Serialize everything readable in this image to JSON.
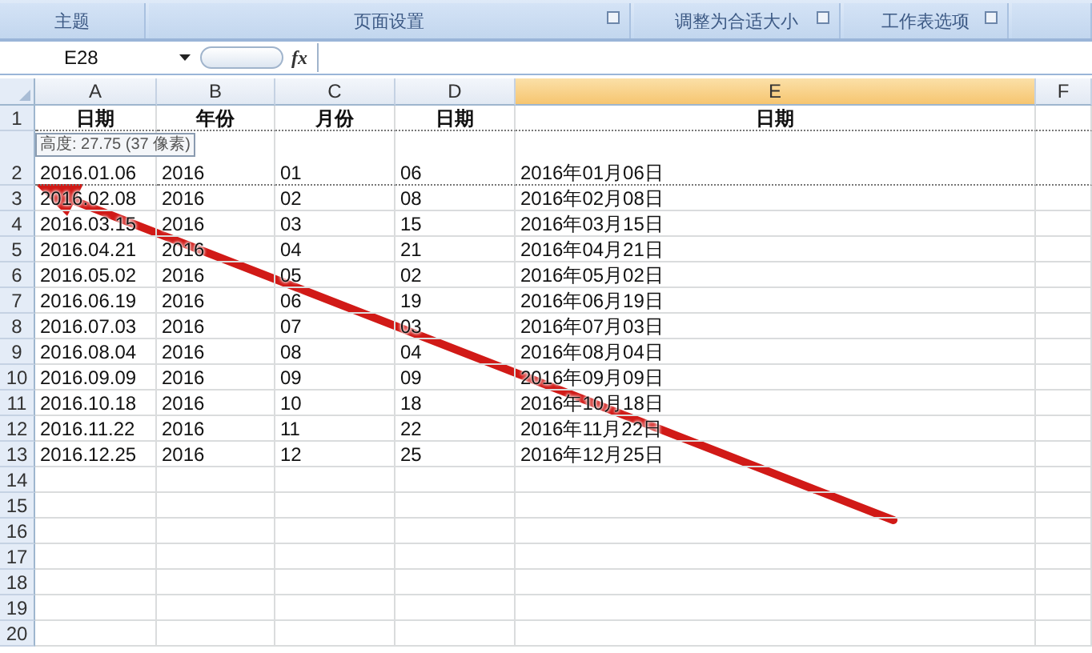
{
  "ribbon_groups": [
    {
      "label": "主题",
      "launcher": false
    },
    {
      "label": "页面设置",
      "launcher": true
    },
    {
      "label": "调整为合适大小",
      "launcher": true
    },
    {
      "label": "工作表选项",
      "launcher": true
    },
    {
      "launcher": false
    }
  ],
  "formula_bar": {
    "name_box": "E28",
    "fx": "fx"
  },
  "columns": [
    {
      "label": "A",
      "selected": false
    },
    {
      "label": "B",
      "selected": false
    },
    {
      "label": "C",
      "selected": false
    },
    {
      "label": "D",
      "selected": false
    },
    {
      "label": "E",
      "selected": true
    },
    {
      "label": "F",
      "selected": false
    }
  ],
  "rows": [
    {
      "number": "1",
      "kind": "header",
      "cells": [
        "日期",
        "年份",
        "月份",
        "日期",
        "日期"
      ]
    },
    {
      "number": "2",
      "kind": "tall",
      "cells": [
        "2016.01.06",
        "2016",
        "01",
        "06",
        "2016年01月06日"
      ]
    },
    {
      "number": "3",
      "kind": "data",
      "cells": [
        "2016.02.08",
        "2016",
        "02",
        "08",
        "2016年02月08日"
      ]
    },
    {
      "number": "4",
      "kind": "data",
      "cells": [
        "2016.03.15",
        "2016",
        "03",
        "15",
        "2016年03月15日"
      ]
    },
    {
      "number": "5",
      "kind": "data",
      "cells": [
        "2016.04.21",
        "2016",
        "04",
        "21",
        "2016年04月21日"
      ]
    },
    {
      "number": "6",
      "kind": "data",
      "cells": [
        "2016.05.02",
        "2016",
        "05",
        "02",
        "2016年05月02日"
      ]
    },
    {
      "number": "7",
      "kind": "data",
      "cells": [
        "2016.06.19",
        "2016",
        "06",
        "19",
        "2016年06月19日"
      ]
    },
    {
      "number": "8",
      "kind": "data",
      "cells": [
        "2016.07.03",
        "2016",
        "07",
        "03",
        "2016年07月03日"
      ]
    },
    {
      "number": "9",
      "kind": "data",
      "cells": [
        "2016.08.04",
        "2016",
        "08",
        "04",
        "2016年08月04日"
      ]
    },
    {
      "number": "10",
      "kind": "data",
      "cells": [
        "2016.09.09",
        "2016",
        "09",
        "09",
        "2016年09月09日"
      ]
    },
    {
      "number": "11",
      "kind": "data",
      "cells": [
        "2016.10.18",
        "2016",
        "10",
        "18",
        "2016年10月18日"
      ]
    },
    {
      "number": "12",
      "kind": "data",
      "cells": [
        "2016.11.22",
        "2016",
        "11",
        "22",
        "2016年11月22日"
      ]
    },
    {
      "number": "13",
      "kind": "data",
      "cells": [
        "2016.12.25",
        "2016",
        "12",
        "25",
        "2016年12月25日"
      ]
    },
    {
      "number": "14",
      "kind": "empty"
    },
    {
      "number": "15",
      "kind": "empty"
    },
    {
      "number": "16",
      "kind": "empty"
    },
    {
      "number": "17",
      "kind": "empty"
    },
    {
      "number": "18",
      "kind": "empty"
    },
    {
      "number": "19",
      "kind": "empty"
    },
    {
      "number": "20",
      "kind": "empty"
    }
  ],
  "tooltip": {
    "text": "高度: 27.75 (37 像素)"
  },
  "annotation": {
    "kind": "arrow"
  }
}
